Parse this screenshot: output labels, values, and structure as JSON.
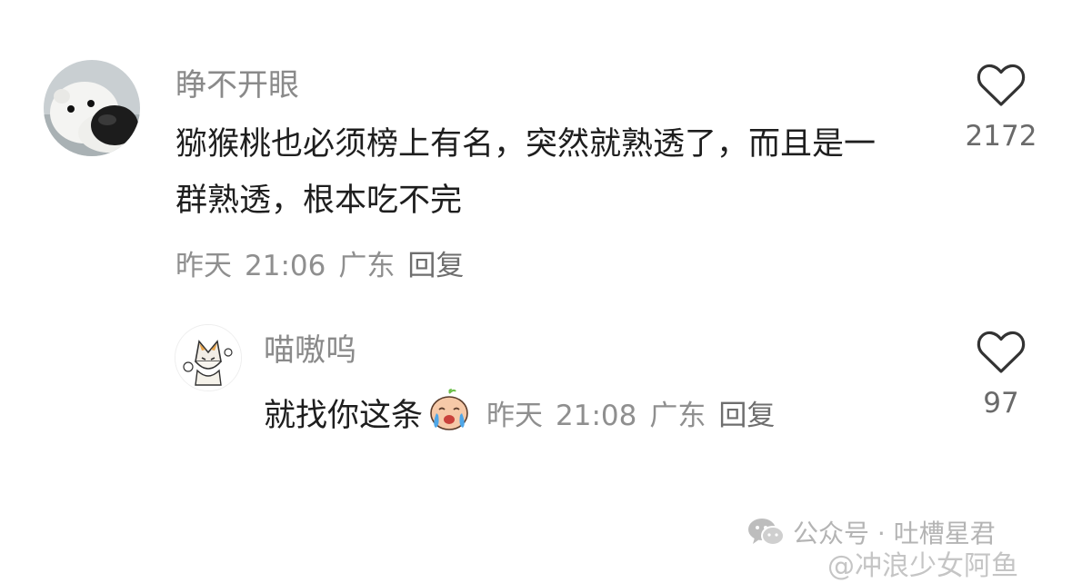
{
  "comment_main": {
    "username": "睁不开眼",
    "content": "猕猴桃也必须榜上有名，突然就熟透了，而且是一群熟透，根本吃不完",
    "date": "昨天",
    "time": "21:06",
    "location": "广东",
    "reply_label": "回复",
    "like_count": "2172",
    "avatar_icon": "polar-bear-avatar"
  },
  "comment_reply": {
    "username": "喵嗷呜",
    "content": "就找你这条",
    "emoji_icon": "crying-face-emoji",
    "date": "昨天",
    "time": "21:08",
    "location": "广东",
    "reply_label": "回复",
    "like_count": "97",
    "avatar_icon": "cartoon-cat-avatar"
  },
  "watermark": {
    "wechat_text": "公众号 · 吐槽星君",
    "weibo_text": "@冲浪少女阿鱼"
  },
  "colors": {
    "username": "#8a8a8a",
    "text": "#1e1e1e",
    "meta": "#8f8f8f",
    "heart": "#333333"
  }
}
